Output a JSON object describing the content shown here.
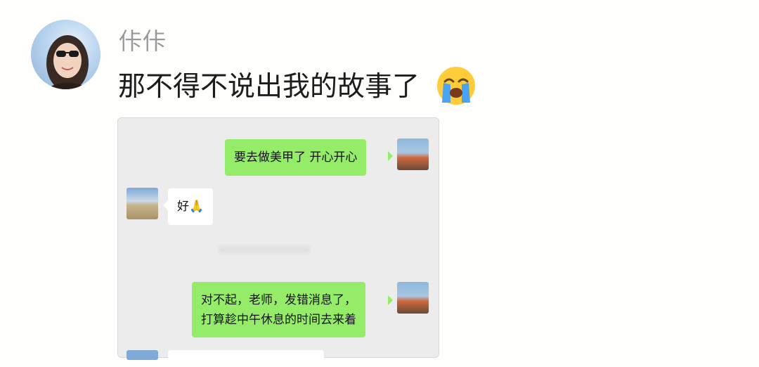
{
  "post": {
    "author": "佧佧",
    "text": "那不得不说出我的故事了",
    "emoji_icon": "loudly-crying-face-icon"
  },
  "chat": {
    "messages": [
      {
        "from": "me",
        "text": "要去做美甲了 开心开心"
      },
      {
        "from": "other",
        "text": "好🙏"
      },
      {
        "from": "me",
        "lines": [
          "对不起，老师，发错消息了，",
          "打算趁中午休息的时间去来着"
        ]
      }
    ]
  },
  "colors": {
    "sent_bubble": "#95ec69",
    "received_bubble": "#ffffff",
    "chat_background": "#ececec"
  }
}
